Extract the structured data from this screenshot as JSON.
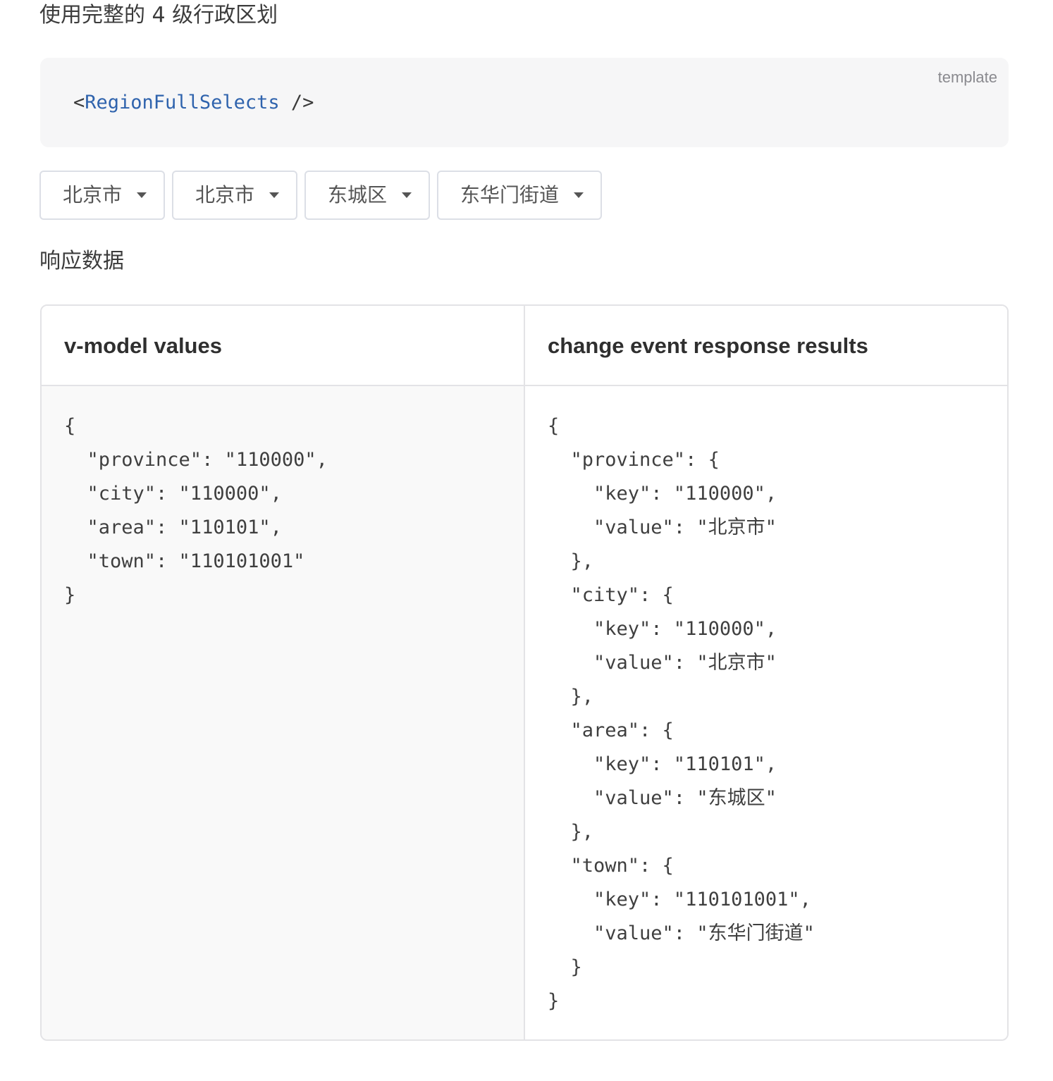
{
  "page_title": "使用完整的 4 级行政区划",
  "code_block": {
    "lang_label": "template",
    "code_open": "<",
    "component_name": "RegionFullSelects",
    "code_close": " />"
  },
  "selects": [
    {
      "value": "北京市"
    },
    {
      "value": "北京市"
    },
    {
      "value": "东城区"
    },
    {
      "value": "东华门街道"
    }
  ],
  "section_heading": "响应数据",
  "table": {
    "headers": [
      "v-model values",
      "change event response results"
    ],
    "vmodel_json": "{\n  \"province\": \"110000\",\n  \"city\": \"110000\",\n  \"area\": \"110101\",\n  \"town\": \"110101001\"\n}",
    "change_json": "{\n  \"province\": {\n    \"key\": \"110000\",\n    \"value\": \"北京市\"\n  },\n  \"city\": {\n    \"key\": \"110000\",\n    \"value\": \"北京市\"\n  },\n  \"area\": {\n    \"key\": \"110101\",\n    \"value\": \"东城区\"\n  },\n  \"town\": {\n    \"key\": \"110101001\",\n    \"value\": \"东华门街道\"\n  }\n}"
  }
}
